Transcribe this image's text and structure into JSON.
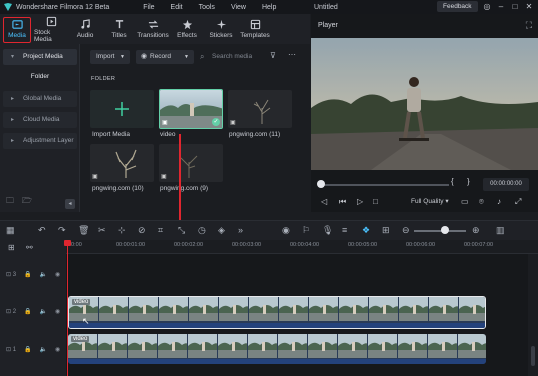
{
  "titlebar": {
    "app_name": "Wondershare Filmora 12 Beta",
    "menu": [
      "File",
      "Edit",
      "Tools",
      "View",
      "Help"
    ],
    "doc_title": "Untitled",
    "feedback": "Feedback"
  },
  "toolbar": {
    "tabs": [
      {
        "label": "Media",
        "icon": "media-icon",
        "active": true
      },
      {
        "label": "Stock Media",
        "icon": "stock-media-icon"
      },
      {
        "label": "Audio",
        "icon": "music-note-icon"
      },
      {
        "label": "Titles",
        "icon": "titles-icon"
      },
      {
        "label": "Transitions",
        "icon": "transitions-icon"
      },
      {
        "label": "Effects",
        "icon": "effects-icon"
      },
      {
        "label": "Stickers",
        "icon": "stickers-icon"
      },
      {
        "label": "Templates",
        "icon": "templates-icon"
      }
    ]
  },
  "sidebar": {
    "project_media": "Project Media",
    "folder": "Folder",
    "global_media": "Global Media",
    "cloud_media": "Cloud Media",
    "adjustment_layer": "Adjustment Layer"
  },
  "media": {
    "import_select": "Import",
    "record_select": "Record",
    "search_placeholder": "Search media",
    "folder_label": "FOLDER",
    "items": [
      {
        "label": "Import Media",
        "kind": "import"
      },
      {
        "label": "video",
        "kind": "video",
        "selected": true
      },
      {
        "label": "pngwing.com (11)",
        "kind": "image"
      },
      {
        "label": "pngwing.com (10)",
        "kind": "image"
      },
      {
        "label": "pngwing.com (9)",
        "kind": "image"
      }
    ]
  },
  "player": {
    "title": "Player",
    "timecode": "00:00:00:00",
    "quality": "Full Quality"
  },
  "timeline": {
    "ticks": [
      "00:00",
      "00:00:01:00",
      "00:00:02:00",
      "00:00:03:00",
      "00:00:04:00",
      "00:00:05:00",
      "00:00:06:00",
      "00:00:07:00"
    ],
    "tracks": [
      {
        "label": "3"
      },
      {
        "label": "2"
      },
      {
        "label": "1"
      }
    ],
    "clip_label": "video"
  },
  "colors": {
    "accent": "#4bc3ff",
    "highlight": "#e0262f",
    "selected_border": "#63d0a8"
  }
}
